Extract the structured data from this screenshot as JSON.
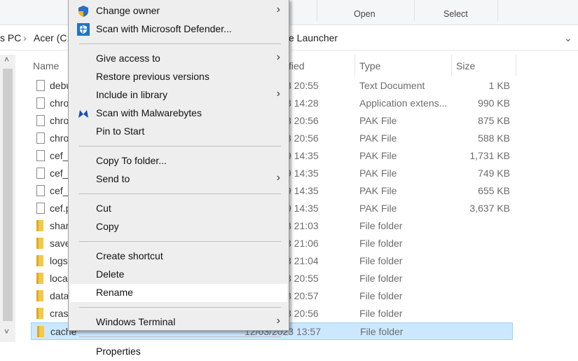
{
  "ribbon": {
    "open_label": "Open",
    "select_label": "Select"
  },
  "address": {
    "crumb1": "s PC",
    "crumb2": "Acer (C:)",
    "crumb_tail": "e Launcher"
  },
  "columns": {
    "name": "Name",
    "modified": "fied",
    "type": "Type",
    "size": "Size"
  },
  "files": [
    {
      "name": "debu",
      "date": "3 20:55",
      "type": "Text Document",
      "size": "1 KB",
      "icon": "text-file"
    },
    {
      "name": "chro",
      "date": "3 14:28",
      "type": "Application extens...",
      "size": "990 KB",
      "icon": "settings-file"
    },
    {
      "name": "chro",
      "date": "3 20:56",
      "type": "PAK File",
      "size": "875 KB",
      "icon": "file"
    },
    {
      "name": "chro",
      "date": "3 20:56",
      "type": "PAK File",
      "size": "588 KB",
      "icon": "file"
    },
    {
      "name": "cef_",
      "date": "9 14:35",
      "type": "PAK File",
      "size": "1,731 KB",
      "icon": "file"
    },
    {
      "name": "cef_",
      "date": "9 14:35",
      "type": "PAK File",
      "size": "749 KB",
      "icon": "file"
    },
    {
      "name": "cef_",
      "date": "9 14:35",
      "type": "PAK File",
      "size": "655 KB",
      "icon": "file"
    },
    {
      "name": "cef.p",
      "date": "9 14:35",
      "type": "PAK File",
      "size": "3,637 KB",
      "icon": "file"
    },
    {
      "name": "shar",
      "date": "3 21:03",
      "type": "File folder",
      "size": "",
      "icon": "folder"
    },
    {
      "name": "save",
      "date": "3 21:06",
      "type": "File folder",
      "size": "",
      "icon": "folder"
    },
    {
      "name": "logs",
      "date": "3 21:04",
      "type": "File folder",
      "size": "",
      "icon": "folder"
    },
    {
      "name": "loca",
      "date": "3 20:55",
      "type": "File folder",
      "size": "",
      "icon": "folder"
    },
    {
      "name": "data",
      "date": "3 20:57",
      "type": "File folder",
      "size": "",
      "icon": "folder"
    },
    {
      "name": "crasl",
      "date": "3 20:56",
      "type": "File folder",
      "size": "",
      "icon": "folder"
    },
    {
      "name": "cache",
      "date": "12/03/2023 13:57",
      "type": "File folder",
      "size": "",
      "icon": "folder",
      "selected": true
    }
  ],
  "menu": [
    {
      "label": "Change owner",
      "icon": "uac-shield",
      "sub": true
    },
    {
      "label": "Scan with Microsoft Defender...",
      "icon": "defender-shield"
    },
    {
      "sep": true
    },
    {
      "label": "Give access to",
      "sub": true
    },
    {
      "label": "Restore previous versions"
    },
    {
      "label": "Include in library",
      "sub": true
    },
    {
      "label": "Scan with Malwarebytes",
      "icon": "malwarebytes"
    },
    {
      "label": "Pin to Start"
    },
    {
      "sep": true
    },
    {
      "label": "Copy To folder..."
    },
    {
      "label": "Send to",
      "sub": true
    },
    {
      "sep": true
    },
    {
      "label": "Cut"
    },
    {
      "label": "Copy"
    },
    {
      "sep": true
    },
    {
      "label": "Create shortcut"
    },
    {
      "label": "Delete"
    },
    {
      "label": "Rename",
      "highlighted": true
    },
    {
      "sep": true
    },
    {
      "label": "Windows Terminal",
      "sub": true
    },
    {
      "sep": true
    },
    {
      "label": "Properties"
    }
  ]
}
